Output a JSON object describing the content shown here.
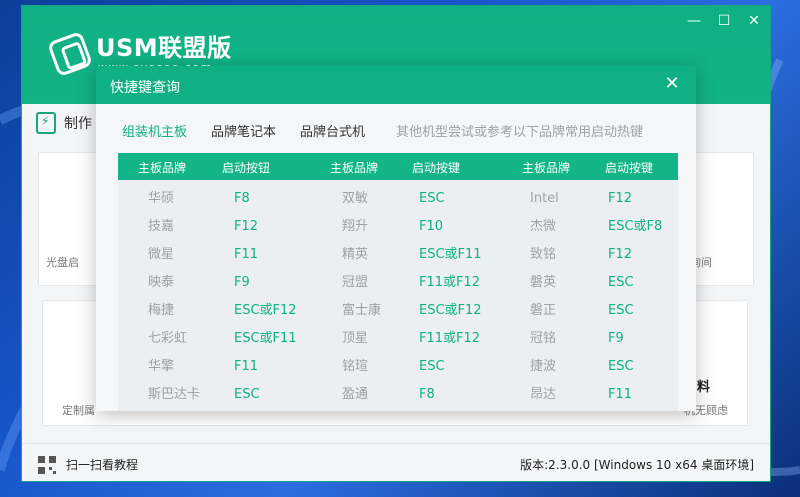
{
  "app": {
    "logo_text": "USM联盟版",
    "logo_sub": "www.sysceo.com",
    "mode_label": "制作",
    "controls": {
      "minimize": "—",
      "maximize": "☐",
      "close": "✕"
    }
  },
  "background_cards": {
    "left_top_text": "光盘启",
    "right_top_text": "询间",
    "left_bottom_text": "定制属",
    "right_bottom_title": "料",
    "right_bottom_text": "机无顾虑"
  },
  "footer": {
    "scan_label": "扫一扫看教程",
    "version": "版本:2.3.0.0 [Windows 10 x64 桌面环境]"
  },
  "dialog": {
    "title": "快捷键查询",
    "close_icon": "✕",
    "tabs": [
      {
        "label": "组装机主板",
        "active": true
      },
      {
        "label": "品牌笔记本",
        "active": false
      },
      {
        "label": "品牌台式机",
        "active": false
      }
    ],
    "hint": "其他机型尝试或参考以下品牌常用启动热键",
    "headers": [
      "主板品牌",
      "启动按钮",
      "主板品牌",
      "启动按键",
      "主板品牌",
      "启动按键"
    ],
    "rows": [
      [
        "华硕",
        "F8",
        "双敏",
        "ESC",
        "Intel",
        "F12"
      ],
      [
        "技嘉",
        "F12",
        "翔升",
        "F10",
        "杰微",
        "ESC或F8"
      ],
      [
        "微星",
        "F11",
        "精英",
        "ESC或F11",
        "致铭",
        "F12"
      ],
      [
        "映泰",
        "F9",
        "冠盟",
        "F11或F12",
        "磐英",
        "ESC"
      ],
      [
        "梅捷",
        "ESC或F12",
        "富士康",
        "ESC或F12",
        "磐正",
        "ESC"
      ],
      [
        "七彩虹",
        "ESC或F11",
        "顶星",
        "F11或F12",
        "冠铭",
        "F9"
      ],
      [
        "华擎",
        "F11",
        "铭瑄",
        "ESC",
        "捷波",
        "ESC"
      ],
      [
        "斯巴达卡",
        "ESC",
        "盈通",
        "F8",
        "昂达",
        "F11"
      ]
    ]
  },
  "colors": {
    "accent": "#0fb085",
    "muted": "#9aa3a8"
  }
}
